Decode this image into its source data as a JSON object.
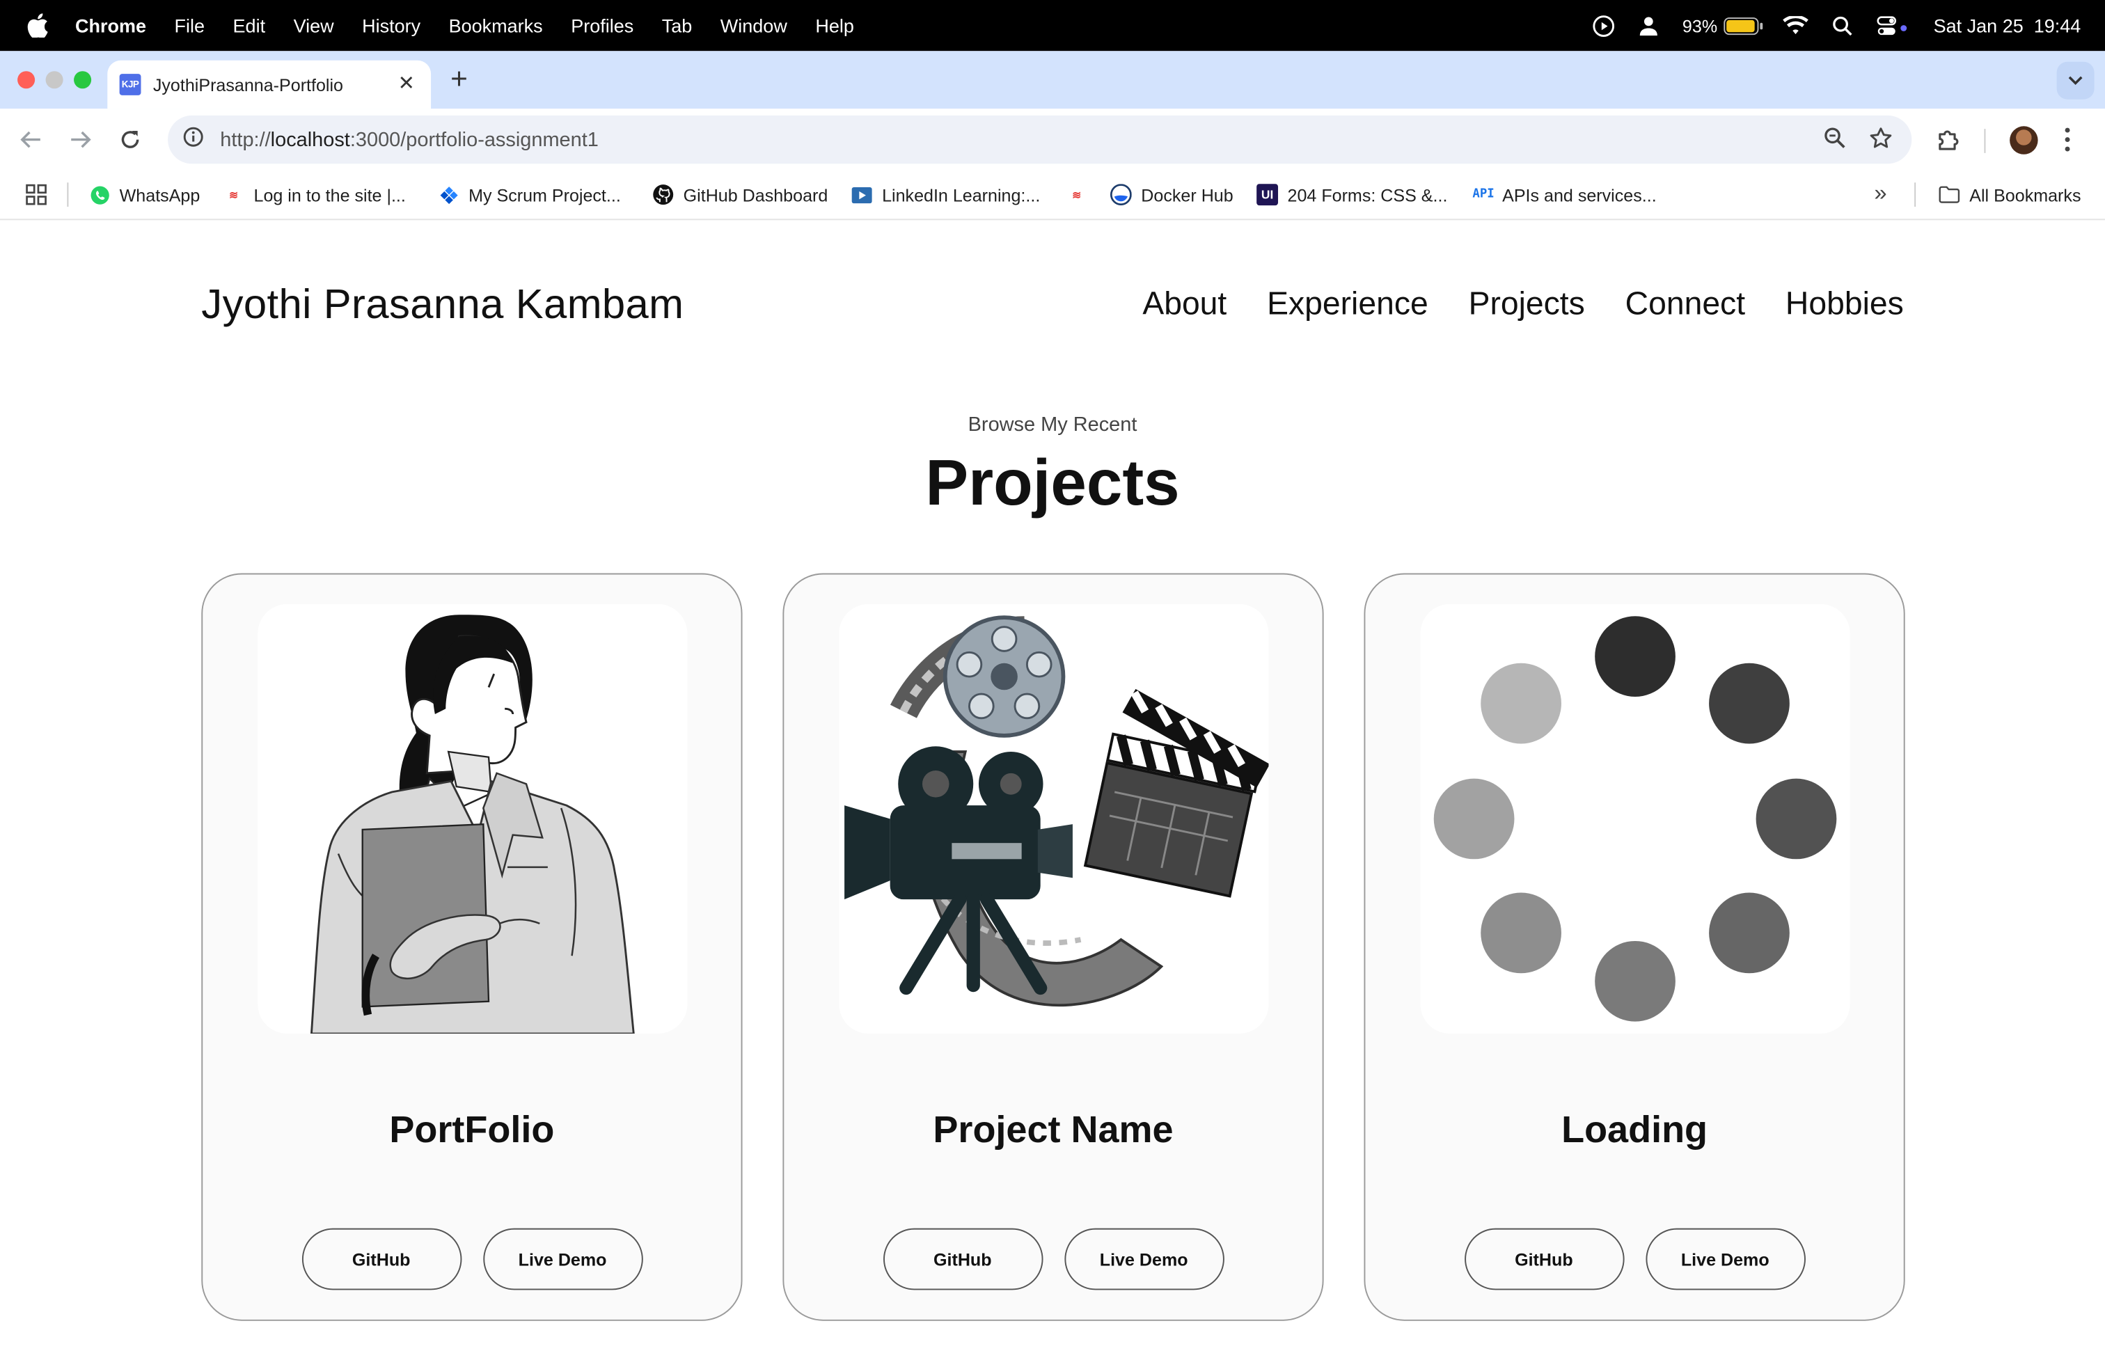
{
  "menubar": {
    "app": "Chrome",
    "items": [
      "File",
      "Edit",
      "View",
      "History",
      "Bookmarks",
      "Profiles",
      "Tab",
      "Window",
      "Help"
    ],
    "battery": "93%",
    "battery_level": 0.93,
    "datetime": "Sat Jan 25  19:44"
  },
  "tab": {
    "favicon": "KJP",
    "title": "JyothiPrasanna-Portfolio",
    "close": "✕",
    "new": "+"
  },
  "omnibox": {
    "scheme": "http://",
    "host": "localhost",
    "path": ":3000/portfolio-assignment1"
  },
  "bookmarks": {
    "items": [
      {
        "label": "WhatsApp",
        "icon": "whatsapp-icon",
        "color": "#25d366"
      },
      {
        "label": "Log in to the site |...",
        "icon": "site-icon",
        "color": "#e53935"
      },
      {
        "label": "My Scrum Project...",
        "icon": "jira-icon",
        "color": "#2684ff"
      },
      {
        "label": "GitHub Dashboard",
        "icon": "github-icon",
        "color": "#111111"
      },
      {
        "label": "LinkedIn Learning:...",
        "icon": "linkedin-learning-icon",
        "color": "#0a66c2"
      },
      {
        "label": "",
        "icon": "site-icon",
        "color": "#e53935"
      },
      {
        "label": "Docker Hub",
        "icon": "docker-icon",
        "color": "#1d63ed"
      },
      {
        "label": "204 Forms: CSS &...",
        "icon": "ui-icon",
        "color": "#3b1f8f"
      },
      {
        "label": "APIs and services...",
        "icon": "api-icon",
        "color": "#1a73e8"
      }
    ],
    "more": "»",
    "all_bookmarks": "All Bookmarks"
  },
  "site": {
    "name": "Jyothi Prasanna Kambam",
    "nav": [
      "About",
      "Experience",
      "Projects",
      "Connect",
      "Hobbies"
    ]
  },
  "projects": {
    "subtitle": "Browse My Recent",
    "title": "Projects",
    "cards": [
      {
        "name": "PortFolio",
        "image": "woman-illustration",
        "github": "GitHub",
        "demo": "Live Demo"
      },
      {
        "name": "Project Name",
        "image": "movie-camera-illustration",
        "github": "GitHub",
        "demo": "Live Demo"
      },
      {
        "name": "Loading",
        "image": "loading-spinner-illustration",
        "github": "GitHub",
        "demo": "Live Demo"
      }
    ]
  }
}
